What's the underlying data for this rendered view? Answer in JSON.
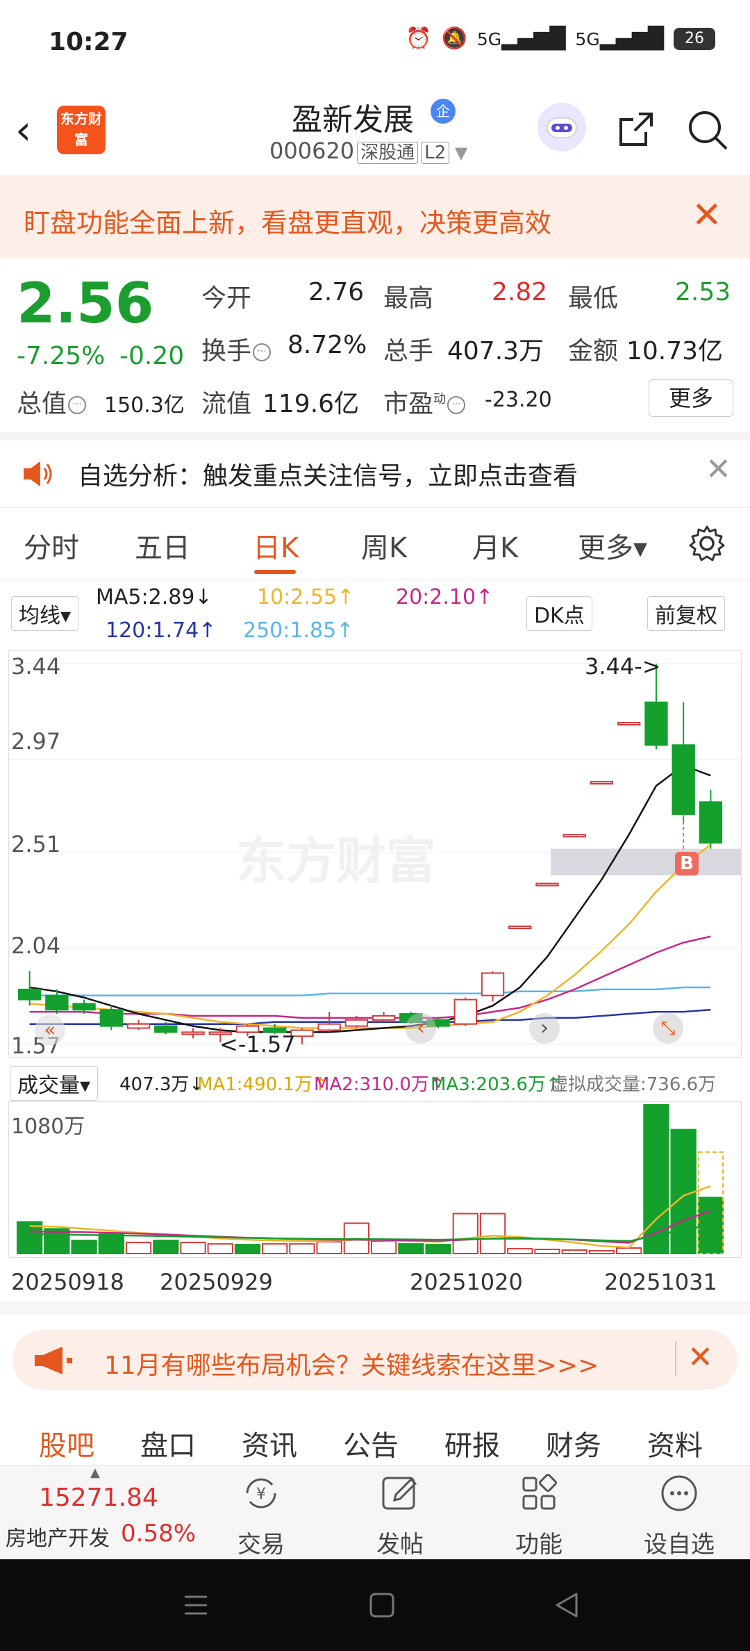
{
  "status": {
    "time": "10:27",
    "battery": "26",
    "signal1": "5G",
    "signal2": "5G"
  },
  "header": {
    "logo": "东方财富",
    "name": "盈新发展",
    "badge": "企",
    "code": "000620",
    "tag1": "深股通",
    "tag2": "L2"
  },
  "banner": {
    "text": "盯盘功能全面上新，看盘更直观，决策更高效",
    "close": "✕"
  },
  "quote": {
    "price": "2.56",
    "change_pct": "-7.25%",
    "change_val": "-0.20",
    "open_label": "今开",
    "open": "2.76",
    "high_label": "最高",
    "high": "2.82",
    "low_label": "最低",
    "low": "2.53",
    "turnover_label": "换手",
    "turnover": "8.72%",
    "volume_label": "总手",
    "volume": "407.3万",
    "amount_label": "金额",
    "amount": "10.73亿",
    "mcap_label": "总值",
    "mcap": "150.3亿",
    "float_label": "流值",
    "float": "119.6亿",
    "pe_label": "市盈",
    "pe_sup": "动",
    "pe": "-23.20",
    "more": "更多"
  },
  "alert": {
    "text": "自选分析：触发重点关注信号，立即点击查看",
    "close": "✕"
  },
  "tabs": [
    "分时",
    "五日",
    "日K",
    "周K",
    "月K",
    "更多▾"
  ],
  "ma": {
    "selector": "均线▾",
    "ma5": "MA5:2.89↓",
    "ma10": "10:2.55↑",
    "ma20": "20:2.10↑",
    "ma120": "120:1.74↑",
    "ma250": "250:1.85↑",
    "dk": "DK点",
    "adjust": "前复权"
  },
  "colors": {
    "up": "#d43a3a",
    "down": "#13a02c",
    "ma5": "#111111",
    "ma10": "#f0b429",
    "ma20": "#c8268a",
    "ma120": "#2534a8",
    "ma250": "#58b7ea",
    "accent": "#e4581f"
  },
  "chart_data": {
    "type": "candlestick",
    "y_ticks": [
      "3.44",
      "2.97",
      "2.51",
      "2.04",
      "1.57"
    ],
    "ylim": [
      1.57,
      3.44
    ],
    "annotations": {
      "high_marker": "3.44->",
      "low_marker": "<-1.57",
      "buy_signal": "B",
      "watermark": "东方财富"
    },
    "candles": [
      {
        "o": 1.84,
        "c": 1.79,
        "h": 1.93,
        "l": 1.76
      },
      {
        "o": 1.81,
        "c": 1.74,
        "h": 1.84,
        "l": 1.72
      },
      {
        "o": 1.77,
        "c": 1.74,
        "h": 1.79,
        "l": 1.72
      },
      {
        "o": 1.74,
        "c": 1.66,
        "h": 1.76,
        "l": 1.64
      },
      {
        "o": 1.65,
        "c": 1.67,
        "h": 1.69,
        "l": 1.64
      },
      {
        "o": 1.66,
        "c": 1.63,
        "h": 1.68,
        "l": 1.62
      },
      {
        "o": 1.62,
        "c": 1.63,
        "h": 1.65,
        "l": 1.6
      },
      {
        "o": 1.62,
        "c": 1.63,
        "h": 1.65,
        "l": 1.58
      },
      {
        "o": 1.63,
        "c": 1.66,
        "h": 1.67,
        "l": 1.61
      },
      {
        "o": 1.65,
        "c": 1.63,
        "h": 1.67,
        "l": 1.62
      },
      {
        "o": 1.61,
        "c": 1.64,
        "h": 1.65,
        "l": 1.57
      },
      {
        "o": 1.64,
        "c": 1.67,
        "h": 1.73,
        "l": 1.63
      },
      {
        "o": 1.66,
        "c": 1.69,
        "h": 1.71,
        "l": 1.65
      },
      {
        "o": 1.69,
        "c": 1.71,
        "h": 1.73,
        "l": 1.68
      },
      {
        "o": 1.72,
        "c": 1.68,
        "h": 1.73,
        "l": 1.67
      },
      {
        "o": 1.69,
        "c": 1.66,
        "h": 1.7,
        "l": 1.65
      },
      {
        "o": 1.67,
        "c": 1.79,
        "h": 1.8,
        "l": 1.66
      },
      {
        "o": 1.81,
        "c": 1.92,
        "h": 1.93,
        "l": 1.78
      },
      {
        "o": 2.15,
        "c": 2.15,
        "h": 2.15,
        "l": 2.15
      },
      {
        "o": 2.36,
        "c": 2.36,
        "h": 2.36,
        "l": 2.36
      },
      {
        "o": 2.6,
        "c": 2.6,
        "h": 2.6,
        "l": 2.6
      },
      {
        "o": 2.86,
        "c": 2.86,
        "h": 2.86,
        "l": 2.86
      },
      {
        "o": 3.15,
        "c": 3.15,
        "h": 3.15,
        "l": 3.15
      },
      {
        "o": 3.25,
        "c": 3.04,
        "h": 3.44,
        "l": 3.02
      },
      {
        "o": 3.04,
        "c": 2.7,
        "h": 3.25,
        "l": 2.65
      },
      {
        "o": 2.76,
        "c": 2.56,
        "h": 2.82,
        "l": 2.53
      }
    ],
    "ma5": [
      1.85,
      1.83,
      1.8,
      1.76,
      1.72,
      1.69,
      1.66,
      1.64,
      1.63,
      1.63,
      1.63,
      1.63,
      1.64,
      1.65,
      1.66,
      1.68,
      1.71,
      1.76,
      1.85,
      2.0,
      2.19,
      2.38,
      2.6,
      2.84,
      2.94,
      2.89
    ],
    "ma10": [
      1.77,
      1.76,
      1.75,
      1.74,
      1.73,
      1.72,
      1.7,
      1.68,
      1.67,
      1.66,
      1.65,
      1.65,
      1.65,
      1.65,
      1.65,
      1.66,
      1.67,
      1.68,
      1.73,
      1.81,
      1.91,
      2.03,
      2.16,
      2.32,
      2.45,
      2.55
    ],
    "ma20": [
      1.73,
      1.73,
      1.73,
      1.72,
      1.72,
      1.72,
      1.71,
      1.71,
      1.71,
      1.71,
      1.7,
      1.7,
      1.7,
      1.7,
      1.7,
      1.7,
      1.71,
      1.73,
      1.75,
      1.79,
      1.84,
      1.9,
      1.96,
      2.02,
      2.07,
      2.1
    ],
    "ma120": [
      1.67,
      1.67,
      1.67,
      1.67,
      1.67,
      1.67,
      1.67,
      1.67,
      1.67,
      1.68,
      1.68,
      1.68,
      1.68,
      1.68,
      1.68,
      1.68,
      1.68,
      1.69,
      1.69,
      1.7,
      1.7,
      1.71,
      1.72,
      1.73,
      1.73,
      1.74
    ],
    "ma250": [
      1.81,
      1.81,
      1.81,
      1.81,
      1.81,
      1.81,
      1.81,
      1.81,
      1.81,
      1.81,
      1.81,
      1.82,
      1.82,
      1.82,
      1.82,
      1.82,
      1.82,
      1.82,
      1.83,
      1.83,
      1.83,
      1.84,
      1.84,
      1.84,
      1.85,
      1.85
    ]
  },
  "volume": {
    "selector": "成交量▾",
    "vol": "407.3万↓",
    "ma1": "MA1:490.1万↑",
    "ma2": "MA2:310.0万↑",
    "ma3": "MA3:203.6万↑",
    "virtual": "虚拟成交量:736.6万",
    "max_label": "1080万",
    "max": 1080,
    "bars": [
      {
        "v": 230,
        "up": false
      },
      {
        "v": 180,
        "up": false
      },
      {
        "v": 95,
        "up": false
      },
      {
        "v": 140,
        "up": false
      },
      {
        "v": 80,
        "up": true
      },
      {
        "v": 95,
        "up": false
      },
      {
        "v": 80,
        "up": true
      },
      {
        "v": 70,
        "up": true
      },
      {
        "v": 65,
        "up": false
      },
      {
        "v": 70,
        "up": true
      },
      {
        "v": 70,
        "up": true
      },
      {
        "v": 85,
        "up": true
      },
      {
        "v": 220,
        "up": true
      },
      {
        "v": 90,
        "up": true
      },
      {
        "v": 70,
        "up": false
      },
      {
        "v": 65,
        "up": false
      },
      {
        "v": 290,
        "up": true
      },
      {
        "v": 290,
        "up": true
      },
      {
        "v": 35,
        "up": true
      },
      {
        "v": 30,
        "up": true
      },
      {
        "v": 25,
        "up": true
      },
      {
        "v": 20,
        "up": true
      },
      {
        "v": 40,
        "up": true
      },
      {
        "v": 1080,
        "up": false
      },
      {
        "v": 900,
        "up": false
      },
      {
        "v": 407,
        "up": false
      }
    ],
    "virtual_value": 736.6,
    "dates": [
      "20250918",
      "20250929",
      "20251020",
      "20251031"
    ]
  },
  "promo": {
    "text": "11月有哪些布局机会？关键线索在这里>>>",
    "close": "✕"
  },
  "bottom_tabs": [
    "股吧",
    "盘口",
    "资讯",
    "公告",
    "研报",
    "财务",
    "资料"
  ],
  "index": {
    "value": "15271.84",
    "name": "房地产开发",
    "pct": "0.58%"
  },
  "bottombar": [
    "交易",
    "发帖",
    "功能",
    "设自选"
  ]
}
